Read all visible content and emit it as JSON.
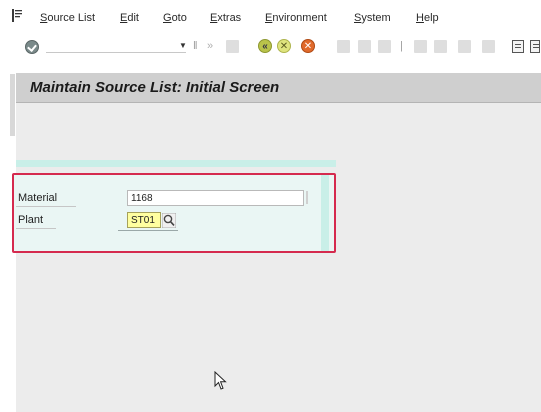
{
  "menu": {
    "items": [
      {
        "key": "source_list",
        "mnemonic": "S",
        "rest": "ource List"
      },
      {
        "key": "edit",
        "mnemonic": "E",
        "rest": "dit"
      },
      {
        "key": "goto",
        "mnemonic": "G",
        "rest": "oto"
      },
      {
        "key": "extras",
        "mnemonic": "E",
        "rest": "xtras"
      },
      {
        "key": "environment",
        "mnemonic": "E",
        "rest": "nvironment"
      },
      {
        "key": "system",
        "mnemonic": "S",
        "rest": "ystem"
      },
      {
        "key": "help",
        "mnemonic": "H",
        "rest": "elp"
      }
    ]
  },
  "toolbar": {
    "command_field_value": "",
    "icons": [
      "ok-icon",
      "dropdown-icon",
      "save-icon",
      "back-icon",
      "exit-icon",
      "cancel-icon",
      "print-icon",
      "find-icon",
      "layout-icon"
    ]
  },
  "title": {
    "text": "Maintain Source List: Initial Screen"
  },
  "form": {
    "material": {
      "label": "Material",
      "value": "1168"
    },
    "plant": {
      "label": "Plant",
      "value": "ST01"
    }
  },
  "colors": {
    "title_bar": "#cfcfcf",
    "content_bg": "#ececec",
    "form_border": "#d52a4e",
    "form_tint": "#c9efe8",
    "required_field": "#ffffa0",
    "back_icon": "#b9c34a",
    "cancel_icon": "#e06a2c"
  }
}
